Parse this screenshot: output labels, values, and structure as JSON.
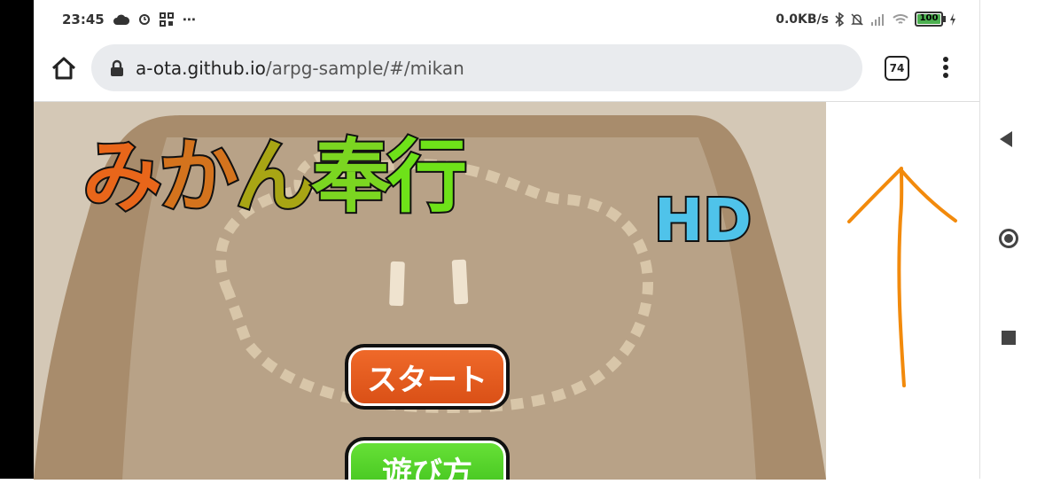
{
  "status_bar": {
    "time": "23:45",
    "overflow": "⋯",
    "net_speed": "0.0KB/s",
    "battery_level": "100",
    "icons": [
      "cloud-icon",
      "alarm-icon",
      "qr-icon",
      "bluetooth-icon",
      "mute-icon",
      "signal-icon",
      "wifi-icon",
      "battery-icon",
      "charging-icon"
    ]
  },
  "toolbar": {
    "url_domain": "a-ota.github.io",
    "url_path": "/arpg-sample/#/mikan",
    "tab_count": "74"
  },
  "game": {
    "title_chars": [
      "み",
      "か",
      "ん",
      "奉",
      "行"
    ],
    "title_colors": [
      "#e8661a",
      "#d4731d",
      "#a8a514",
      "#7bd621",
      "#6ee219"
    ],
    "title_suffix": "HD",
    "start_label": "スタート",
    "howto_label": "遊び方"
  },
  "annotation": {
    "color": "#f28a0c",
    "icon": "up-arrow"
  },
  "colors": {
    "accent_start": "#e0561b",
    "accent_howto": "#46c820",
    "hd": "#4fc3ea"
  }
}
